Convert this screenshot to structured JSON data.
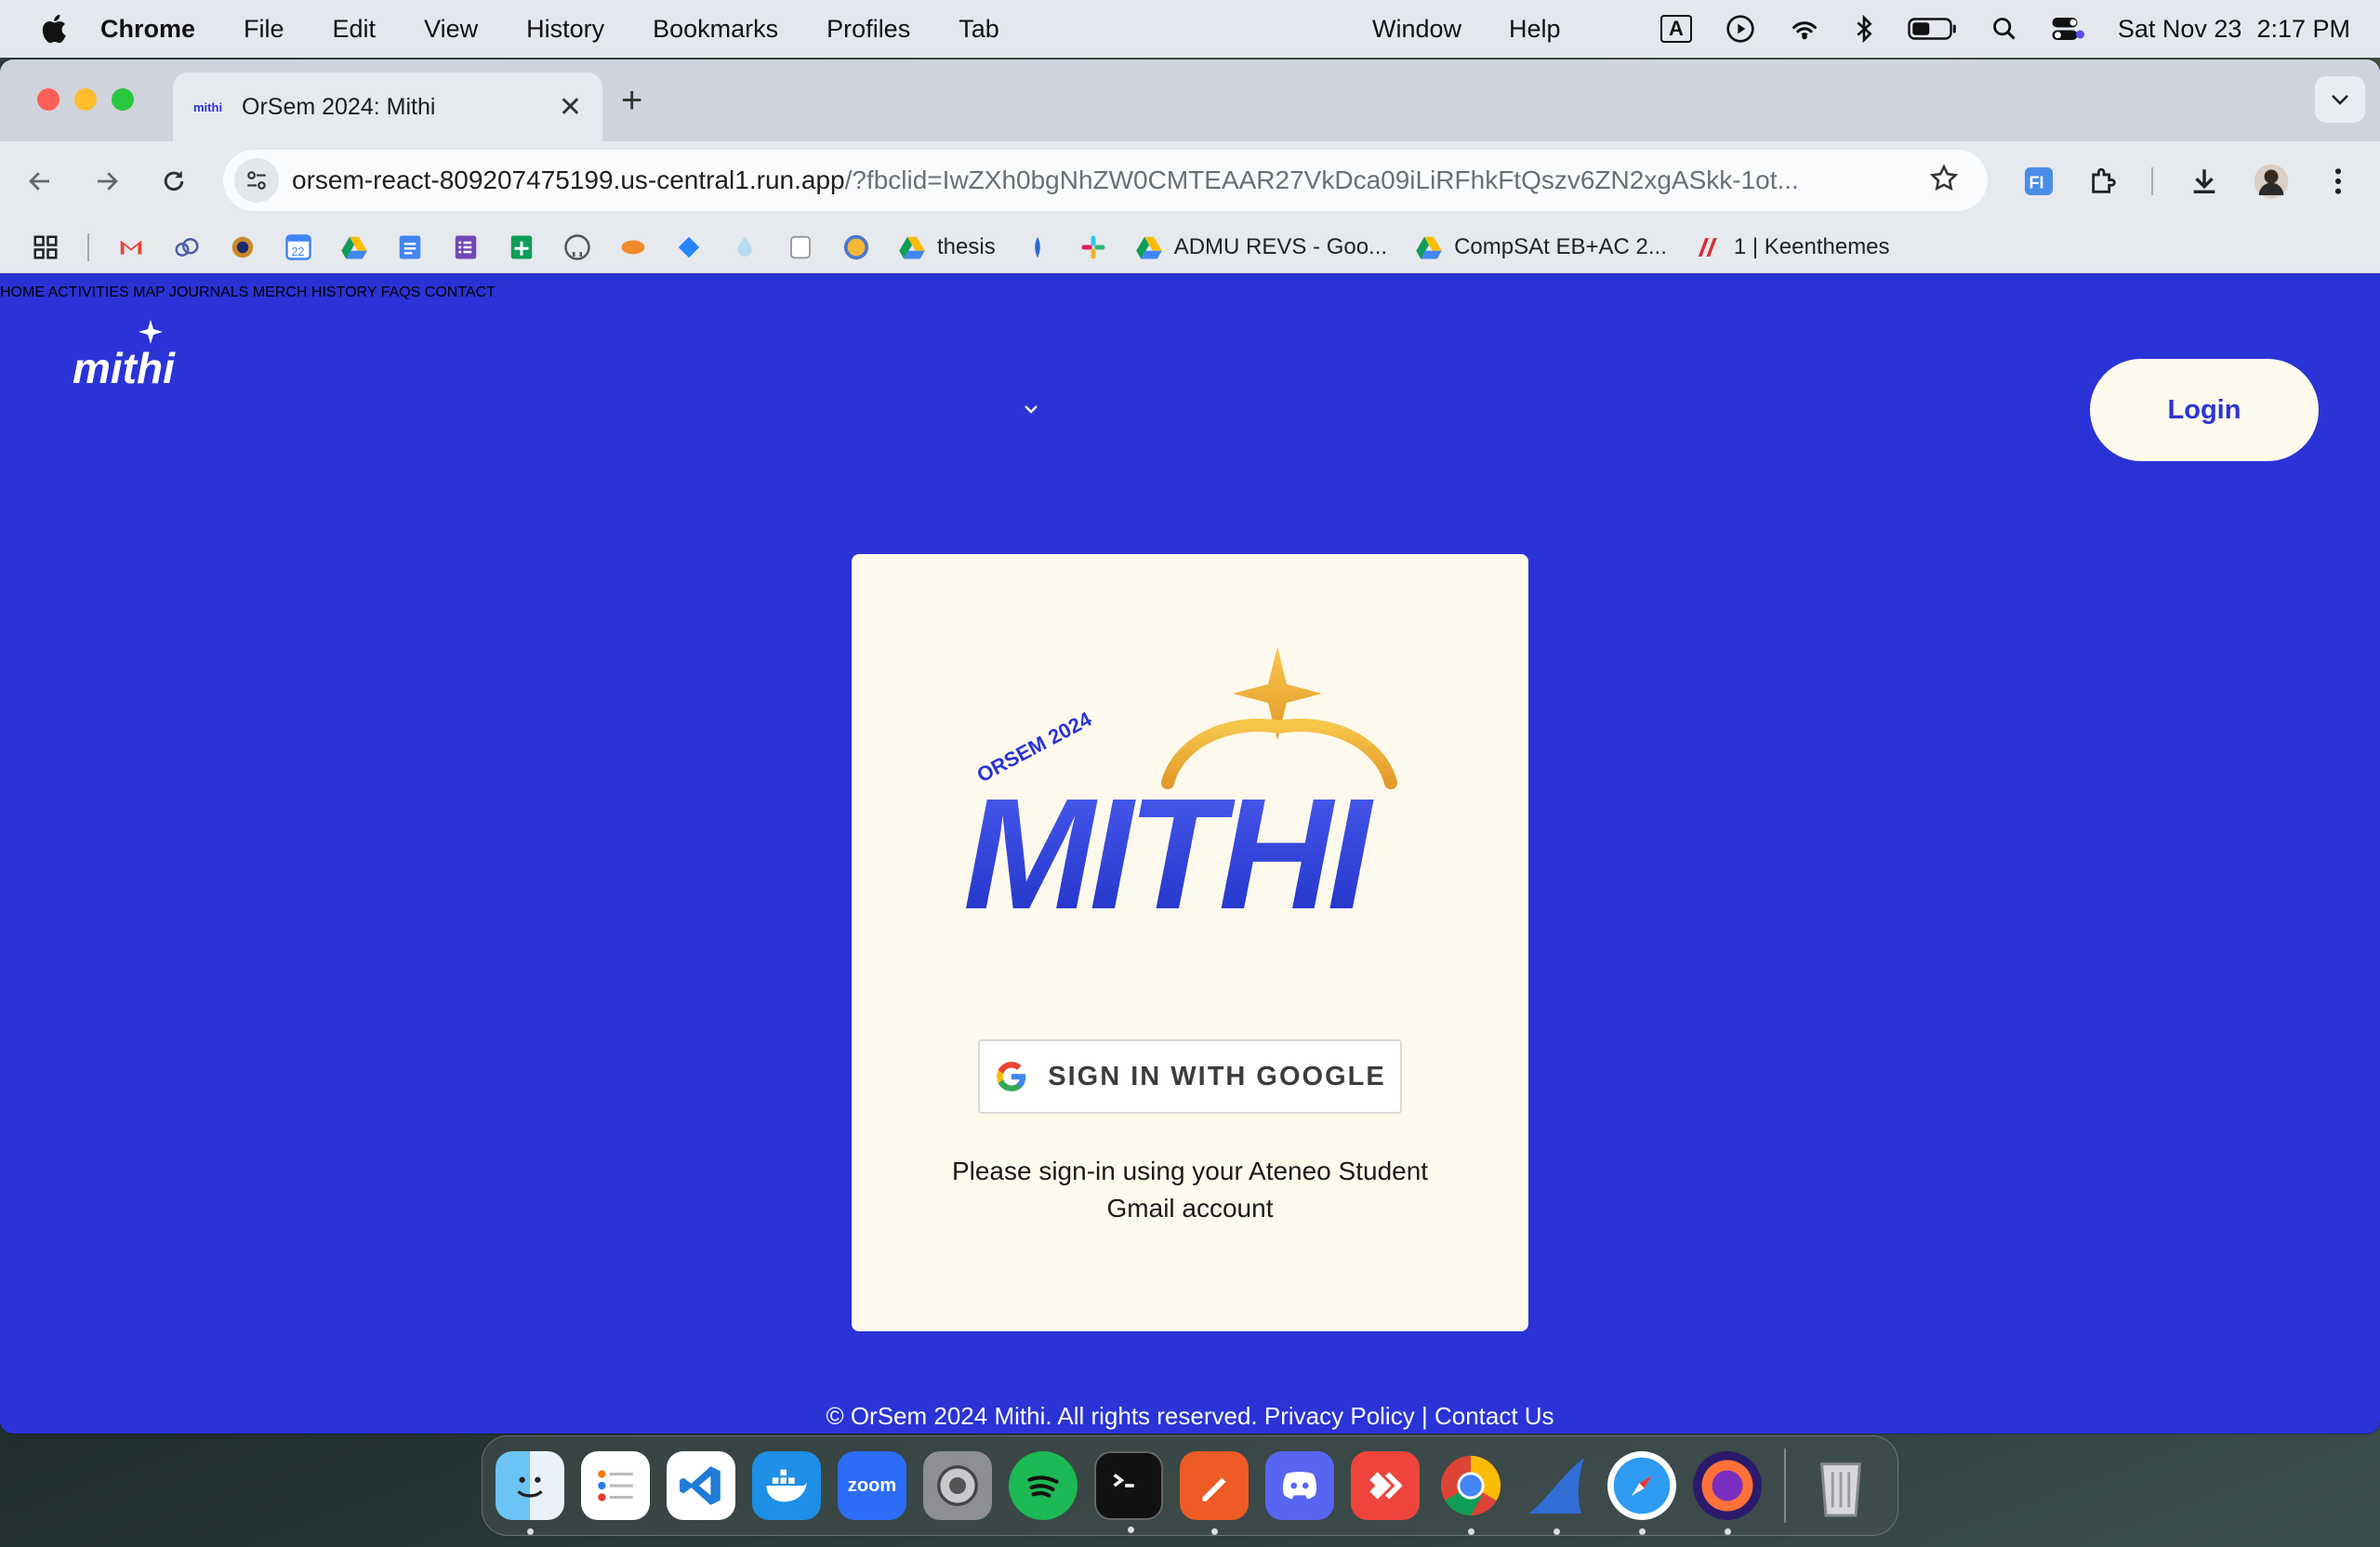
{
  "menubar": {
    "app": "Chrome",
    "items": [
      "File",
      "Edit",
      "View",
      "History",
      "Bookmarks",
      "Profiles",
      "Tab"
    ],
    "window": "Window",
    "help": "Help",
    "date": "Sat Nov 23",
    "time": "2:17 PM",
    "input_source": "A"
  },
  "browser": {
    "tab_title": "OrSem 2024: Mithi",
    "url_host": "orsem-react-809207475199.us-central1.run.app",
    "url_path": "/?fbclid=IwZXh0bgNhZW0CMTEAAR27VkDca09iLiRFhkFtQszv6ZN2xgASkk-1ot...",
    "bookmarks": [
      {
        "label": "thesis"
      },
      {
        "label": "ADMU REVS - Goo..."
      },
      {
        "label": "CompSAt EB+AC 2..."
      },
      {
        "label": "1 | Keenthemes"
      }
    ],
    "calendar_day": "22"
  },
  "site": {
    "nav": {
      "home": "HOME",
      "activities": "ACTIVITIES",
      "map": "MAP",
      "journals": "JOURNALS",
      "merch": "MERCH",
      "history": "HISTORY",
      "faqs": "FAQS",
      "contact": "CONTACT",
      "login": "Login"
    },
    "card": {
      "badge": "ORSEM 2024",
      "logo_text": "MITHI",
      "google_button": "SIGN IN WITH GOOGLE",
      "note": "Please sign-in using your Ateneo Student Gmail account"
    },
    "footer": {
      "copyright": "© OrSem 2024 Mithi. All rights reserved.",
      "privacy": "Privacy Policy",
      "divider": "|",
      "contact": "Contact Us"
    }
  },
  "colors": {
    "brand_blue": "#2a33d6",
    "cream": "#fdf9ec",
    "gold": "#f0b43a"
  },
  "dock": {
    "apps": [
      "Finder",
      "Reminders",
      "VS Code",
      "Docker",
      "Zoom",
      "System Settings",
      "Spotify",
      "Terminal",
      "Postman",
      "Discord",
      "AnyDesk",
      "Chrome",
      "Wireshark",
      "Safari",
      "Firefox",
      "Trash"
    ],
    "zoom_label": "zoom"
  }
}
